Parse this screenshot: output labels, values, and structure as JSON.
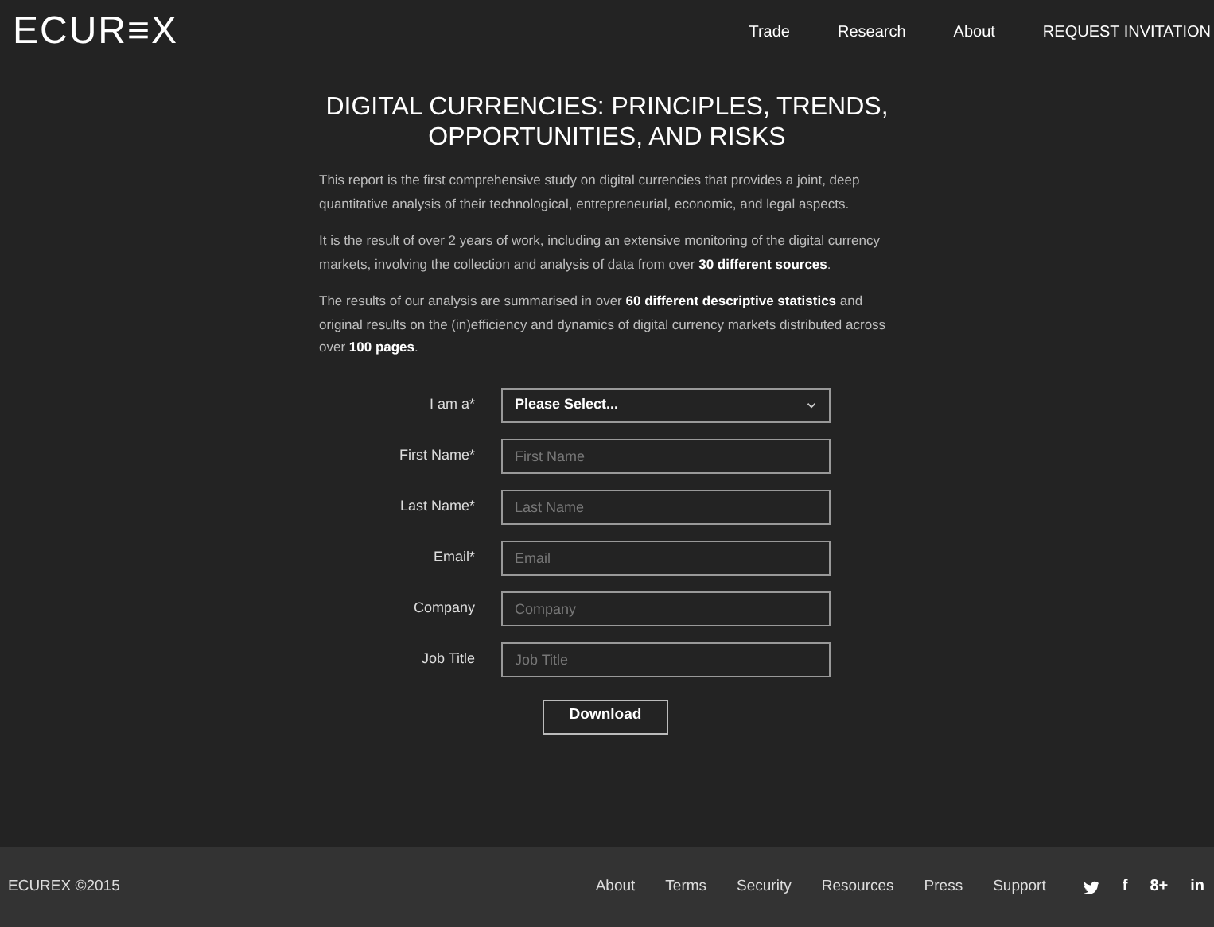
{
  "header": {
    "logo": "ECUR≡X",
    "nav": [
      "Trade",
      "Research",
      "About",
      "REQUEST INVITATION"
    ]
  },
  "title": "DIGITAL CURRENCIES: PRINCIPLES, TRENDS, OPPORTUNITIES, AND RISKS",
  "paragraphs": [
    "This report is the first comprehensive study on digital currencies that provides a joint, deep quantitative analysis of their technological, entrepreneurial, economic, and legal aspects.",
    "It is the result of over 2 years of work, including an extensive monitoring of the digital currency markets, involving the collection and analysis of data from over **30 different sources**.",
    "The results of our analysis are summarised in over **60 different descriptive statistics** and original results on the (in)efficiency and dynamics of digital currency markets distributed across over **100 pages**."
  ],
  "form": {
    "fields": [
      {
        "kind": "select",
        "label": "I am a*",
        "value": "Please Select..."
      },
      {
        "kind": "text",
        "label": "First Name*",
        "placeholder": "First Name"
      },
      {
        "kind": "text",
        "label": "Last Name*",
        "placeholder": "Last Name"
      },
      {
        "kind": "text",
        "label": "Email*",
        "placeholder": "Email"
      },
      {
        "kind": "text",
        "label": "Company",
        "placeholder": "Company"
      },
      {
        "kind": "text",
        "label": "Job Title",
        "placeholder": "Job Title"
      }
    ],
    "submit": "Download"
  },
  "footer": {
    "copyright": "ECUREX ©2015",
    "links": [
      "About",
      "Terms",
      "Security",
      "Resources",
      "Press",
      "Support"
    ],
    "social": [
      {
        "kind": "bird"
      },
      {
        "kind": "glyph",
        "text": "f"
      },
      {
        "kind": "glyph",
        "text": "8+"
      },
      {
        "kind": "glyph",
        "text": "in"
      }
    ]
  }
}
